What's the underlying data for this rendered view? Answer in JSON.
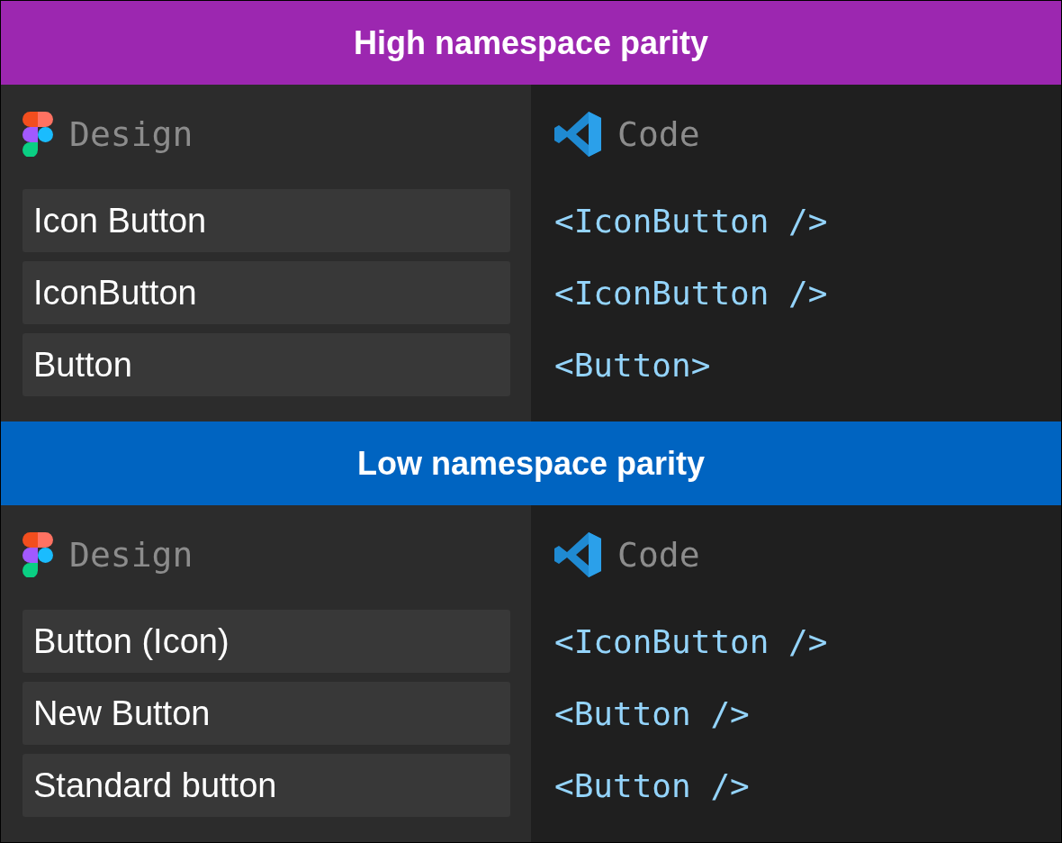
{
  "sections": [
    {
      "title": "High namespace parity",
      "color": "#9c27b0",
      "design_label": "Design",
      "code_label": "Code",
      "rows": [
        {
          "design": "Icon Button",
          "code": "<IconButton />"
        },
        {
          "design": "IconButton",
          "code": "<IconButton />"
        },
        {
          "design": "Button",
          "code": "<Button>"
        }
      ]
    },
    {
      "title": "Low namespace parity",
      "color": "#0064c1",
      "design_label": "Design",
      "code_label": "Code",
      "rows": [
        {
          "design": "Button (Icon)",
          "code": "<IconButton />"
        },
        {
          "design": "New Button",
          "code": "<Button />"
        },
        {
          "design": "Standard button",
          "code": "<Button />"
        }
      ]
    }
  ]
}
